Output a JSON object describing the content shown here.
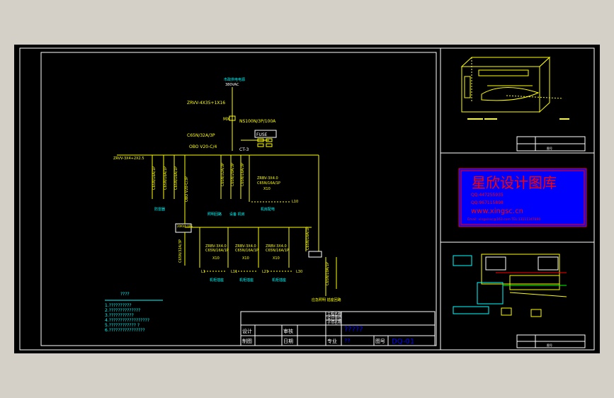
{
  "main": {
    "power_source": "市政供电电源",
    "voltage": "380VAC",
    "cable_main": "ZRVV-4X35+1X16",
    "switch_main": "NS100N/3P/100A",
    "breaker_1": "C65N/32A/3P",
    "fuse_label": "FUSE",
    "breaker_2": "OBO V20-C/4",
    "ct_label": "CT-3",
    "cable_branch": "ZRVV-3X4+2X2.5",
    "br_a1": "C65N/16A/1P",
    "br_a2": "C65N/16A/1P",
    "br_a3": "C65N/16A/1P",
    "br_a4": "OBO V20-C/3P",
    "br_b1": "C65N/32A/3P",
    "br_b2": "C65N/20A/3P",
    "br_b3": "C65N/16A/3P",
    "cable_b1": "ZRVV-3X2.5",
    "cable_b2": "ZRVV-3X4.0",
    "cab_ctrl_1": "ZRBV-3X4.0",
    "cab_ctrl_2": "C65N/16A/1P",
    "cab_ctrl_3": "X10",
    "l10": "L10",
    "label_lighting": "照明回路",
    "label_equipment": "设备 机房",
    "label_a": "机房配电",
    "label_left": "防雷器",
    "ups_label": "20KVA UPS",
    "ups_sw": "C65N/32A/3P",
    "bank": [
      {
        "cable": "ZRBV-3X4.0",
        "breaker": "C65N/16A/1P",
        "qty": "X10",
        "line": "L1"
      },
      {
        "cable": "ZRBV-3X4.0",
        "breaker": "C65N/16A/1P",
        "qty": "X10",
        "line": "L11"
      },
      {
        "cable": "ZRBV-3X4.0",
        "breaker": "C65N/16A/1P",
        "qty": "X10",
        "line": "L21"
      },
      {
        "cable": "ZRBV-3X4.0",
        "breaker": "C65N/16A/1P",
        "qty": "X10",
        "line": "L30"
      }
    ],
    "bank_labels": [
      "机柜插座",
      "机柜插座",
      "机柜插座"
    ],
    "right_sw": "C65N/16A/1P",
    "right_sw2": "C65N/10A/1P",
    "em_label": "应急照明 插座回路",
    "notes_title": "????",
    "notes": [
      "1.??????????",
      "2.??????????????",
      "3.???????????",
      "4.??????????????????",
      "5.???????????? ?",
      "6.????????????????"
    ]
  },
  "titleblock": {
    "r1": "工程名称",
    "r2": "设计单位",
    "r3": "子项名称",
    "name_value": "?????",
    "design": "设计",
    "review": "审核",
    "draw": "制图",
    "date": "日期",
    "major": "专业",
    "major_value": "??",
    "drawing_no_label": "图号",
    "drawing_no": "DQ-01"
  },
  "watermark": {
    "title": "星欣设计图库",
    "qq1": "QQ:447255935",
    "qq2": "QQ:967115898",
    "website": "www.xingsc.cn",
    "email": "Email: xingxinsc@163.com   TEL:13111347890"
  },
  "small_labels": [
    "图号",
    "图号"
  ],
  "colors": {
    "bg": "#000000",
    "frame": "#ffffff",
    "line": "#ffff00",
    "cyan": "#00ffff",
    "red": "#ff0000",
    "blue": "#0000ff",
    "green": "#00ff00",
    "white": "#ffffff"
  }
}
